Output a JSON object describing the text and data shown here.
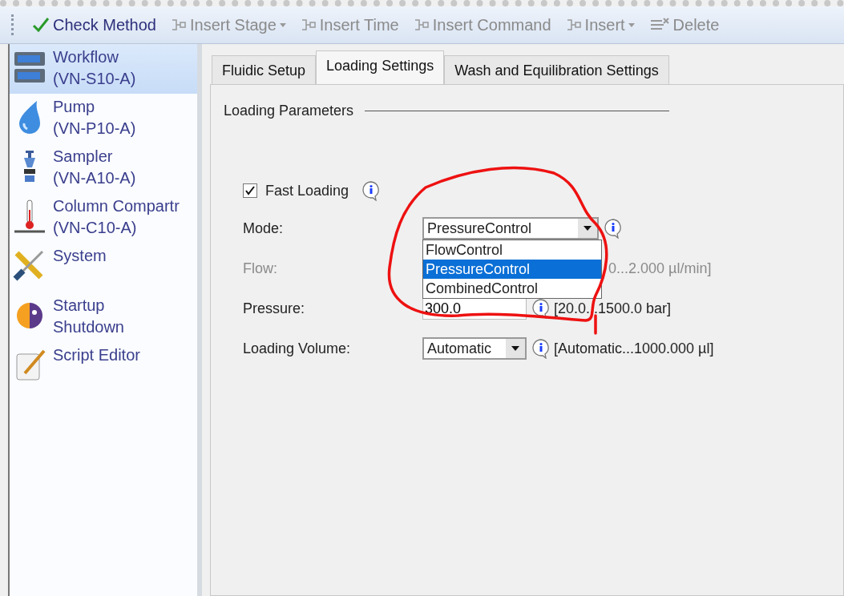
{
  "toolbar": [
    {
      "label": "Check Method",
      "kind": "check",
      "has_menu": false,
      "disabled": false
    },
    {
      "label": "Insert Stage",
      "kind": "insert",
      "has_menu": true,
      "disabled": true
    },
    {
      "label": "Insert Time",
      "kind": "insert",
      "has_menu": false,
      "disabled": true
    },
    {
      "label": "Insert Command",
      "kind": "insert",
      "has_menu": false,
      "disabled": true
    },
    {
      "label": "Insert",
      "kind": "insert",
      "has_menu": true,
      "disabled": true
    },
    {
      "label": "Delete",
      "kind": "delete",
      "has_menu": false,
      "disabled": true
    }
  ],
  "sidebar": {
    "items": [
      {
        "name": "Workflow",
        "sub": "(VN-S10-A)",
        "kind": "workflow",
        "selected": true
      },
      {
        "name": "Pump",
        "sub": "(VN-P10-A)",
        "kind": "pump",
        "selected": false
      },
      {
        "name": "Sampler",
        "sub": "(VN-A10-A)",
        "kind": "sampler",
        "selected": false
      },
      {
        "name": "Column Compartr",
        "sub": "(VN-C10-A)",
        "kind": "thermo",
        "selected": false
      },
      {
        "name": "System",
        "kind": "tools",
        "selected": false
      },
      {
        "name": "Startup",
        "sub": "Shutdown",
        "kind": "daynight",
        "selected": false
      },
      {
        "name": "Script Editor",
        "kind": "script",
        "selected": false
      }
    ]
  },
  "tabs": [
    {
      "label": "Fluidic Setup",
      "selected": false
    },
    {
      "label": "Loading Settings",
      "selected": true
    },
    {
      "label": "Wash and Equilibration Settings",
      "selected": false
    }
  ],
  "group_title": "Loading Parameters",
  "fast_loading": {
    "label": "Fast Loading",
    "checked": true
  },
  "rows": [
    {
      "label": "Mode:",
      "kind": "mode",
      "value": "PressureControl",
      "disabled": false,
      "options": [
        {
          "label": "FlowControl",
          "selected": false
        },
        {
          "label": "PressureControl",
          "selected": true
        },
        {
          "label": "CombinedControl",
          "selected": false
        }
      ]
    },
    {
      "label": "Flow:",
      "kind": "hidden",
      "range": "0...2.000 µl/min]",
      "disabled": true
    },
    {
      "label": "Pressure:",
      "kind": "text",
      "value": "300.0",
      "range": "[20.0...1500.0 bar]",
      "disabled": false
    },
    {
      "label": "Loading Volume:",
      "kind": "combo",
      "value": "Automatic",
      "range": "[Automatic...1000.000 µl]",
      "disabled": false
    }
  ]
}
